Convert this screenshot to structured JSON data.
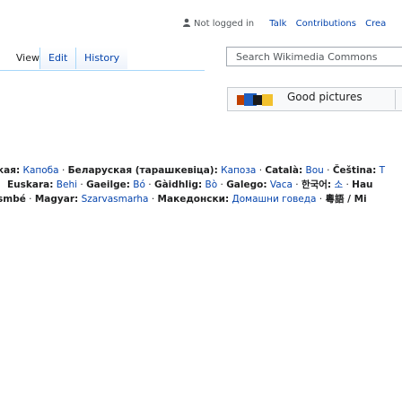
{
  "user_links": {
    "not_logged_in": "Not logged in",
    "talk": "Talk",
    "contributions": "Contributions",
    "create": "Crea"
  },
  "tabs": {
    "view": "View",
    "edit": "Edit",
    "history": "History"
  },
  "search": {
    "placeholder": "Search Wikimedia Commons"
  },
  "good_pictures": {
    "label": "Good pictures"
  },
  "languages": [
    {
      "lang": "кая:",
      "value": "Капоба"
    },
    {
      "lang": "Беларуская (тарашкевіца):",
      "value": "Капоза"
    },
    {
      "lang": "Català:",
      "value": "Bou"
    },
    {
      "lang": "Čeština:",
      "value": "T"
    },
    {
      "lang": "Euskara:",
      "value": "Behi"
    },
    {
      "lang": "Gaeilge:",
      "value": "Bó"
    },
    {
      "lang": "Gàidhlig:",
      "value": "Bò"
    },
    {
      "lang": "Galego:",
      "value": "Vaca"
    },
    {
      "lang": "한국어:",
      "value": "소"
    },
    {
      "lang": "Hau",
      "value": ""
    },
    {
      "lang": "smbé",
      "value": ""
    },
    {
      "lang": "Magyar:",
      "value": "Szarvasmarha"
    },
    {
      "lang": "Македонски:",
      "value": "Домашни говеда"
    },
    {
      "lang": "",
      "value": "粵語 / Mi"
    }
  ],
  "colors": {
    "link": "#0645ad",
    "tab_border": "#a7d7f9",
    "text": "#202122"
  }
}
